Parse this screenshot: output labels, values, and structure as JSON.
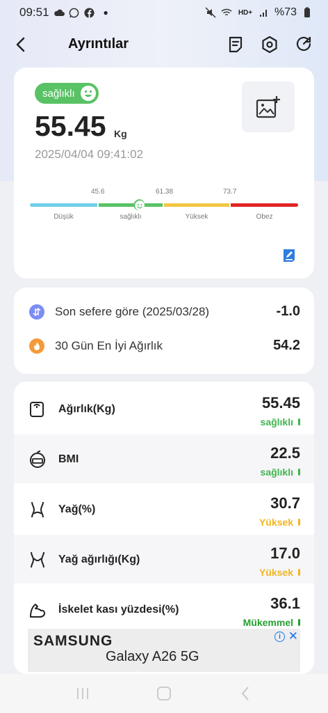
{
  "status_bar": {
    "time": "09:51",
    "battery": "%73"
  },
  "header": {
    "title": "Ayrıntılar"
  },
  "summary": {
    "badge": "sağlıklı",
    "weight": "55.45",
    "unit": "Kg",
    "datetime": "2025/04/04 09:41:02",
    "scale_ticks": [
      "45.6",
      "61.38",
      "73.7"
    ],
    "segments": [
      {
        "label": "Düşük",
        "color": "#6ecfe9"
      },
      {
        "label": "sağlıklı",
        "color": "#59c265"
      },
      {
        "label": "Yüksek",
        "color": "#f2c744"
      },
      {
        "label": "Obez",
        "color": "#e02424"
      }
    ]
  },
  "comparison": [
    {
      "label": "Son sefere göre (2025/03/28)",
      "value": "-1.0",
      "icon": "compare-icon",
      "color": "#7b8cf6"
    },
    {
      "label": "30 Gün En İyi Ağırlık",
      "value": "54.2",
      "icon": "fire-icon",
      "color": "#f59a3a"
    }
  ],
  "metrics": [
    {
      "label": "Ağırlık(Kg)",
      "value": "55.45",
      "status": "sağlıklı",
      "status_color": "#3fb54e",
      "icon": "scale-icon"
    },
    {
      "label": "BMI",
      "value": "22.5",
      "status": "sağlıklı",
      "status_color": "#3fb54e",
      "icon": "bmi-icon"
    },
    {
      "label": "Yağ(%)",
      "value": "30.7",
      "status": "Yüksek",
      "status_color": "#f2b51f",
      "icon": "body-fat-icon"
    },
    {
      "label": "Yağ ağırlığı(Kg)",
      "value": "17.0",
      "status": "Yüksek",
      "status_color": "#f2b51f",
      "icon": "fat-weight-icon"
    },
    {
      "label": "İskelet kası yüzdesi(%)",
      "value": "36.1",
      "status": "Mükemmel",
      "status_color": "#25a02f",
      "icon": "muscle-icon"
    }
  ],
  "ad": {
    "brand": "SAMSUNG",
    "product": "Galaxy A26 5G"
  }
}
